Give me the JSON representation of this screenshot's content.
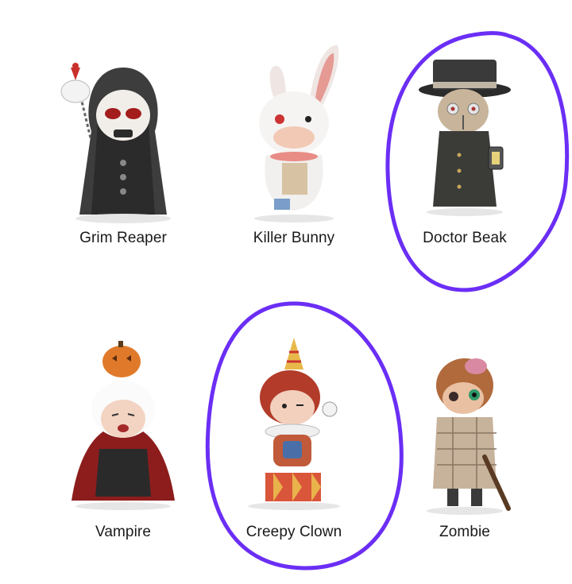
{
  "figures": [
    {
      "name": "Grim Reaper",
      "icon": "grim-reaper-figure",
      "circled": false
    },
    {
      "name": "Killer Bunny",
      "icon": "killer-bunny-figure",
      "circled": false
    },
    {
      "name": "Doctor Beak",
      "icon": "doctor-beak-figure",
      "circled": true
    },
    {
      "name": "Vampire",
      "icon": "vampire-figure",
      "circled": false
    },
    {
      "name": "Creepy Clown",
      "icon": "creepy-clown-figure",
      "circled": true
    },
    {
      "name": "Zombie",
      "icon": "zombie-figure",
      "circled": false
    }
  ],
  "colors": {
    "circle": "#6b2ef5",
    "label": "#1a1a1a",
    "background": "#ffffff"
  }
}
